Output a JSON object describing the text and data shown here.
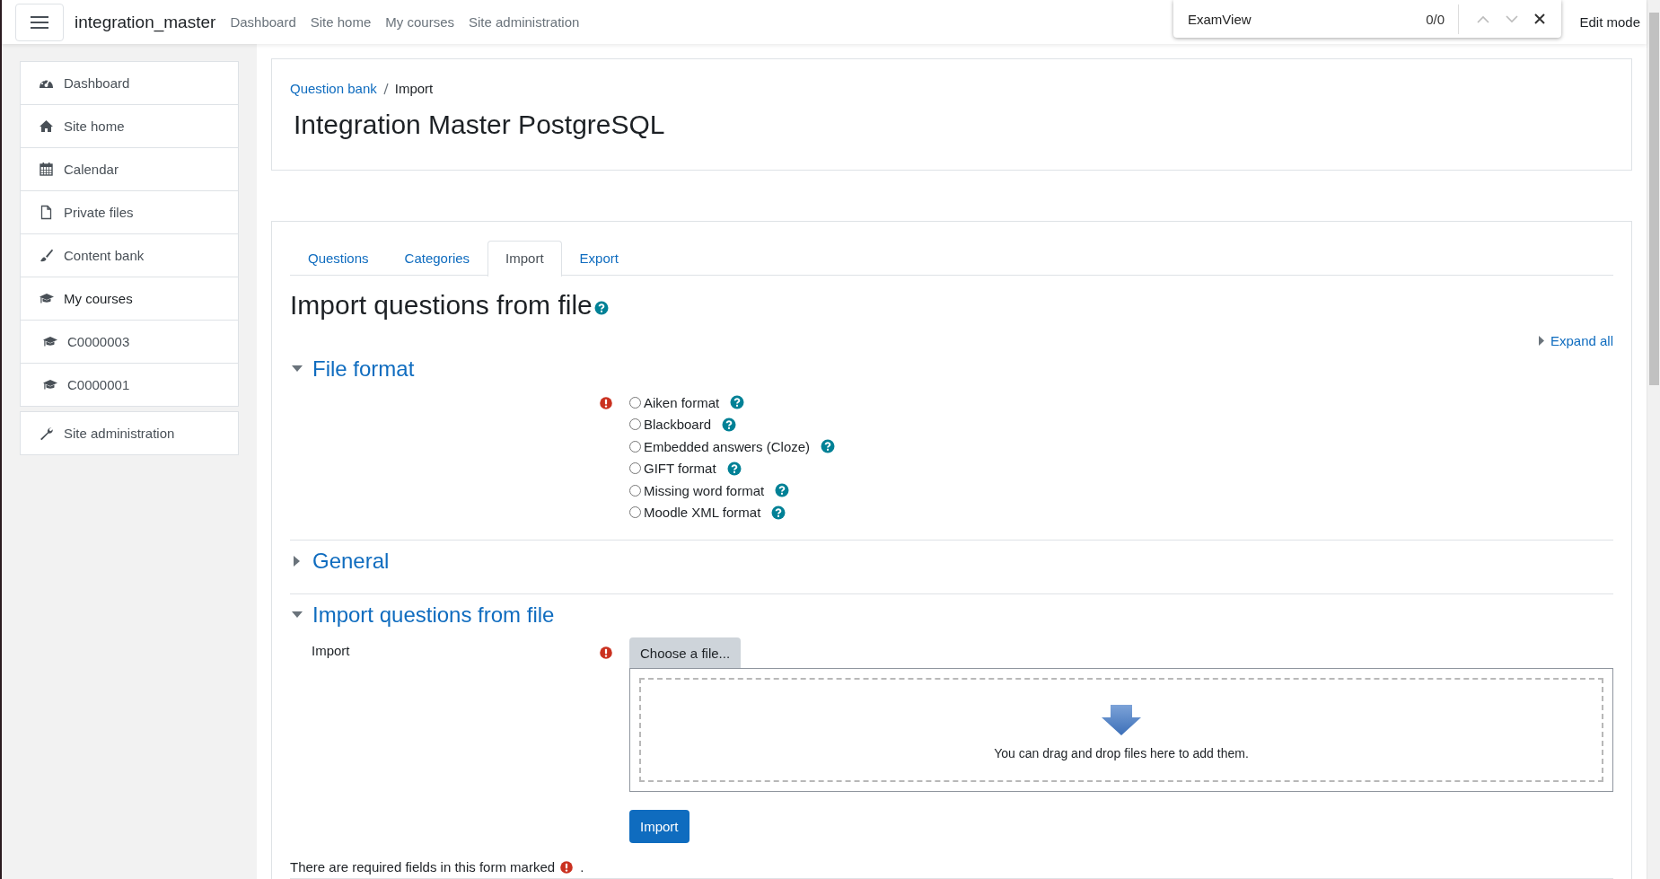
{
  "topbar": {
    "site_name": "integration_master",
    "nav": [
      "Dashboard",
      "Site home",
      "My courses",
      "Site administration"
    ],
    "edit_mode": "Edit mode"
  },
  "find_bar": {
    "query": "ExamView",
    "count": "0/0"
  },
  "sidebar": {
    "groups": [
      {
        "items": [
          {
            "label": "Dashboard",
            "selected": false
          },
          {
            "label": "Site home",
            "selected": false
          },
          {
            "label": "Calendar",
            "selected": false
          },
          {
            "label": "Private files",
            "selected": false
          },
          {
            "label": "Content bank",
            "selected": false
          },
          {
            "label": "My courses",
            "selected": true,
            "children": [
              {
                "label": "C0000003",
                "selected": false
              },
              {
                "label": "C0000001",
                "selected": false
              }
            ]
          }
        ]
      },
      {
        "items": [
          {
            "label": "Site administration",
            "selected": false
          }
        ]
      }
    ]
  },
  "header": {
    "breadcrumb": [
      {
        "label": "Question bank",
        "current": false
      },
      {
        "label": "Import",
        "current": true
      }
    ],
    "title": "Integration Master PostgreSQL"
  },
  "tabs": [
    {
      "label": "Questions",
      "selected": false
    },
    {
      "label": "Categories",
      "selected": false
    },
    {
      "label": "Import",
      "selected": true
    },
    {
      "label": "Export",
      "selected": false
    }
  ],
  "heading": "Import questions from file",
  "expand_all": "Expand all",
  "sections": [
    {
      "title": "File format",
      "expanded": true,
      "kind": "radios",
      "required": true,
      "options": [
        {
          "label": "Aiken format",
          "selected": false
        },
        {
          "label": "Blackboard",
          "selected": false
        },
        {
          "label": "Embedded answers (Cloze)",
          "selected": false
        },
        {
          "label": "GIFT format",
          "selected": false
        },
        {
          "label": "Missing word format",
          "selected": false
        },
        {
          "label": "Moodle XML format",
          "selected": false
        }
      ]
    },
    {
      "title": "General",
      "expanded": false
    },
    {
      "title": "Import questions from file",
      "expanded": true,
      "kind": "filepicker",
      "label": "Import",
      "required": true,
      "button": "Choose a file...",
      "drop_text": "You can drag and drop files here to add them."
    }
  ],
  "submit": "Import",
  "footnote": {
    "text": "There are required fields in this form marked",
    "end": "."
  }
}
